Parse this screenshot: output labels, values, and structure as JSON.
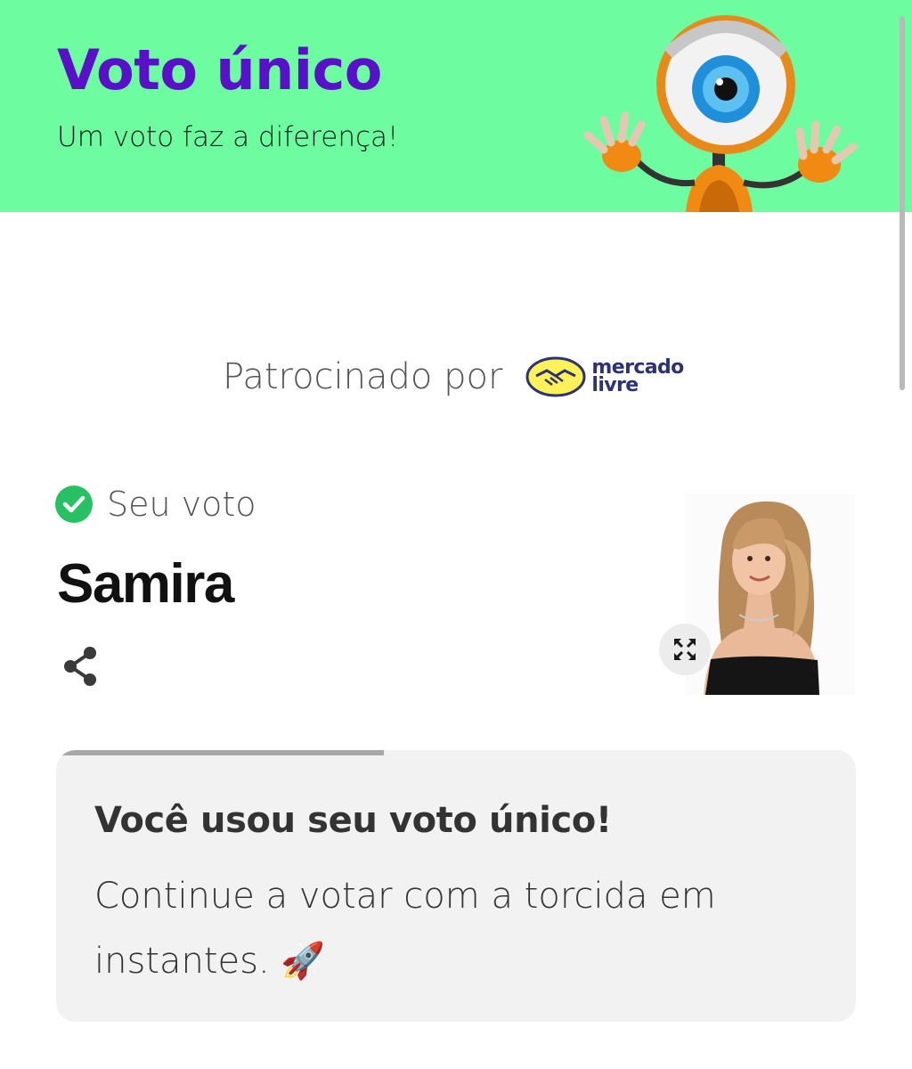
{
  "header": {
    "title": "Voto único",
    "subtitle": "Um voto faz a diferença!",
    "background_color": "#6dfca0",
    "title_color": "#5a0fc8",
    "mascot_icon": "big-brother-eye-mascot"
  },
  "sponsor": {
    "label": "Patrocinado por",
    "logo_line1": "mercado",
    "logo_line2": "livre",
    "logo_icon": "handshake-icon"
  },
  "vote": {
    "label": "Seu voto",
    "candidate": "Samira",
    "check_icon": "check-circle-icon",
    "check_color": "#27c163",
    "share_icon": "share-icon",
    "expand_icon": "expand-icon"
  },
  "card": {
    "title": "Você usou seu voto único!",
    "body": "Continue a votar com a torcida em instantes. 🚀",
    "progress_fraction": 0.41
  }
}
